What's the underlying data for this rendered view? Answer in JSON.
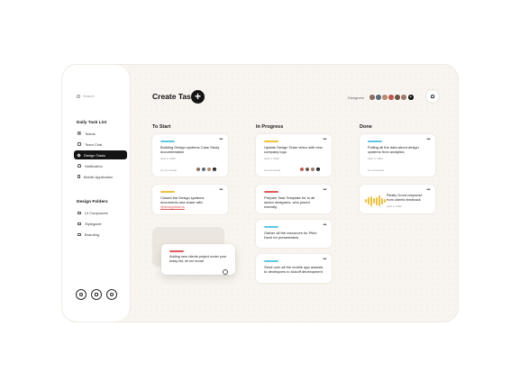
{
  "sidebar": {
    "search_placeholder": "Search",
    "section1_title": "Daily Task List",
    "nav": [
      {
        "label": "Teams",
        "icon": "grid-icon"
      },
      {
        "label": "Team Chat",
        "icon": "chat-icon"
      },
      {
        "label": "Design Tasks",
        "icon": "pen-icon",
        "active": true
      },
      {
        "label": "Notification",
        "icon": "bell-icon"
      },
      {
        "label": "Mobile Application",
        "icon": "phone-icon"
      }
    ],
    "section2_title": "Design Folders",
    "folders": [
      {
        "label": "UI Componets"
      },
      {
        "label": "Styleguide"
      },
      {
        "label": "Branding"
      }
    ],
    "bottom_icons": [
      "settings-icon",
      "mail-icon",
      "help-icon"
    ]
  },
  "header": {
    "title": "Create Task",
    "add_glyph": "+",
    "designers_label": "Designers",
    "designer_colors": [
      "#8b6f5e",
      "#5a6c7d",
      "#b88a6e",
      "#c0584c",
      "#6b5a4c",
      "#a3786a"
    ],
    "more_glyph": "+"
  },
  "columns": {
    "todo": "To Start",
    "progress": "In Progress",
    "done": "Done"
  },
  "colors": {
    "blue": "#5ec9e6",
    "yellow": "#f0c13b",
    "red": "#e25a5a",
    "accent": "#141414"
  },
  "cards": {
    "c1": {
      "title": "Building Design systems Case Study documentation",
      "date": "April 2, 2022",
      "comments": "12 comments"
    },
    "c2": {
      "title_pre": "Closed the Design systems documents and share with ",
      "mention": "@designteams"
    },
    "float": {
      "title": "Adding new clients project under your today list. let me know!"
    },
    "p1": {
      "title": "Update Design Team video with new company logo",
      "date": "April 2, 2022",
      "comments": "12 comments"
    },
    "p2": {
      "title": "Prepare Task Template for to all senior designers, who joined recently."
    },
    "p3": {
      "title": "Gather all the resources for Pitch Deck for presentation."
    },
    "p4": {
      "title": "Send over all the mobile app assests to developers to kickoff development"
    },
    "d1": {
      "title": "Pulling all the data about design systems from analytics",
      "date": "April 2, 2022",
      "comments": "12 comments"
    },
    "d2": {
      "title": "Really Good response from clients feedback",
      "date": "April 2, 2022"
    }
  }
}
